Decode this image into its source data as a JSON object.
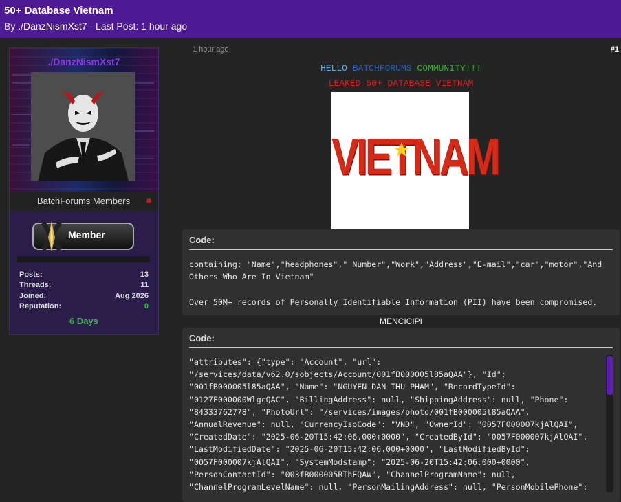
{
  "thread": {
    "title": "50+ Database Vietnam",
    "by_prefix": "By",
    "author": "./DanzNismXst7",
    "last_post_text": " - Last Post: 1 hour ago"
  },
  "profile": {
    "username": "./DanzNismXst7",
    "group": "BatchForums Members",
    "rank_label": "Member",
    "stats": [
      {
        "label": "Posts:",
        "value": "13"
      },
      {
        "label": "Threads:",
        "value": "11"
      },
      {
        "label": "Joined:",
        "value": "Aug 2026"
      },
      {
        "label": "Reputation:",
        "value": "0"
      }
    ],
    "days": "6 Days",
    "colors": {
      "username": "#8a37e0",
      "online_dot": "#c41818",
      "reputation": "#2bcc2b",
      "days": "#3fae4e"
    }
  },
  "post": {
    "time": "1 hour ago",
    "number": "#1",
    "hello_words": [
      "HELLO",
      "BATCHFORUMS",
      "COMMUNITY!!!"
    ],
    "leaked_line": "LEAKED 50+ DATABASE VIETNAM",
    "image_text": "VIETNAM",
    "code1_header": "Code:",
    "code1_text": "containing: \"Name\",\"headphones\",\" Number\",\"Work\",\"Address\",\"E-mail\",\"car\",\"motor\",\"And Others Who Are In Vietnam\"\n\nOver 50M+ records of Personally Identifiable Information (PII) have been compromised.",
    "mid_text": "MENCICIPI",
    "code2_header": "Code:",
    "code2_text": "\"attributes\": {\"type\": \"Account\", \"url\":\n\"/services/data/v62.0/sobjects/Account/001fB000005l85aQAA\"}, \"Id\":\n\"001fB000005l85aQAA\", \"Name\": \"NGUYEN DAN THU PHAM\", \"RecordTypeId\":\n\"0127F000000WlgcQAC\", \"BillingAddress\": null, \"ShippingAddress\": null, \"Phone\":\n\"84333762778\", \"PhotoUrl\": \"/services/images/photo/001fB000005l85aQAA\",\n\"AnnualRevenue\": null, \"CurrencyIsoCode\": \"VND\", \"OwnerId\": \"0057F000007kjAlQAI\",\n\"CreatedDate\": \"2025-06-20T15:42:06.000+0000\", \"CreatedById\": \"0057F000007kjAlQAI\",\n\"LastModifiedDate\": \"2025-06-20T15:42:06.000+0000\", \"LastModifiedById\":\n\"0057F000007kjAlQAI\", \"SystemModstamp\": \"2025-06-20T15:42:06.000+0000\",\n\"PersonContactId\": \"003fB000005RThEQAW\", \"ChannelProgramName\": null,\n\"ChannelProgramLevelName\": null, \"PersonMailingAddress\": null, \"PersonMobilePhone\":",
    "colors": {
      "hello": "#4db4ef",
      "batchforums": "#1f62c4",
      "community": "#2bb32b",
      "leaked": "#e01b1b",
      "scroll_thumb": "#5d1fb0"
    }
  }
}
